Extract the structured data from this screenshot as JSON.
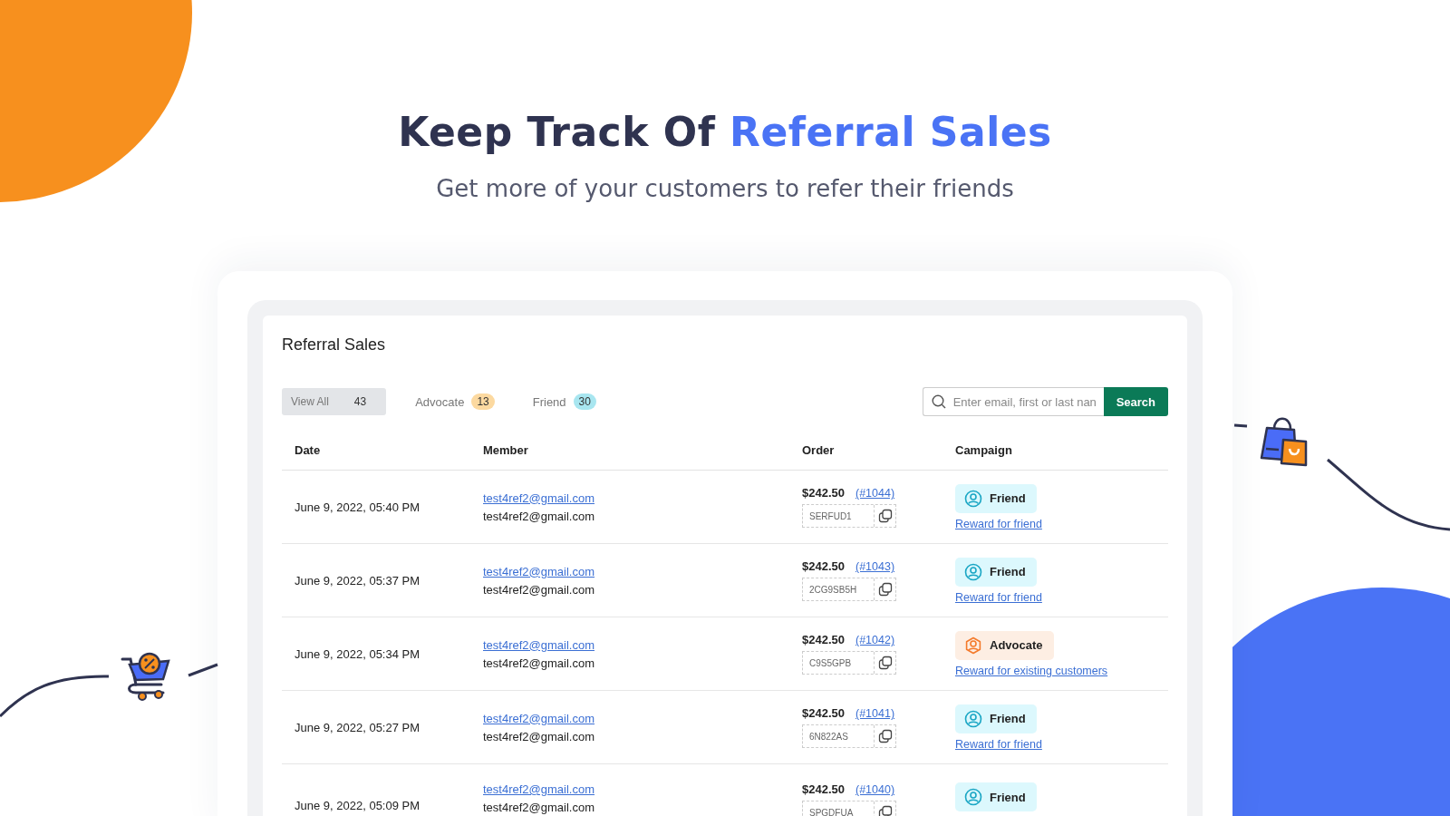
{
  "headline": {
    "text": "Keep Track Of",
    "highlight": "Referral Sales"
  },
  "subtitle": "Get more of your customers to refer their friends",
  "panel": {
    "title": "Referral Sales",
    "tabs": [
      {
        "label": "View All",
        "count": "43",
        "selected": true
      },
      {
        "label": "Advocate",
        "count": "13",
        "selected": false,
        "color": "#fcd9a0"
      },
      {
        "label": "Friend",
        "count": "30",
        "selected": false,
        "color": "#a8e6f0"
      }
    ],
    "search": {
      "placeholder": "Enter email, first or last nan",
      "button": "Search"
    },
    "columns": [
      "Date",
      "Member",
      "Order",
      "Campaign"
    ],
    "rows": [
      {
        "date": "June 9, 2022, 05:40 PM",
        "member_link": "test4ref2@gmail.com",
        "member": "test4ref2@gmail.com",
        "amount": "$242.50",
        "order": "(#1044)",
        "code": "SERFUD1",
        "campaign": {
          "kind": "friend",
          "label": "Friend"
        },
        "reward": "Reward for friend"
      },
      {
        "date": "June 9, 2022, 05:37 PM",
        "member_link": "test4ref2@gmail.com",
        "member": "test4ref2@gmail.com",
        "amount": "$242.50",
        "order": "(#1043)",
        "code": "2CG9SB5H",
        "campaign": {
          "kind": "friend",
          "label": "Friend"
        },
        "reward": "Reward for friend"
      },
      {
        "date": "June 9, 2022, 05:34 PM",
        "member_link": "test4ref2@gmail.com",
        "member": "test4ref2@gmail.com",
        "amount": "$242.50",
        "order": "(#1042)",
        "code": "C9S5GPB",
        "campaign": {
          "kind": "advocate",
          "label": "Advocate"
        },
        "reward": "Reward for existing customers"
      },
      {
        "date": "June 9, 2022, 05:27 PM",
        "member_link": "test4ref2@gmail.com",
        "member": "test4ref2@gmail.com",
        "amount": "$242.50",
        "order": "(#1041)",
        "code": "6N822AS",
        "campaign": {
          "kind": "friend",
          "label": "Friend"
        },
        "reward": "Reward for friend"
      },
      {
        "date": "June 9, 2022, 05:09 PM",
        "member_link": "test4ref2@gmail.com",
        "member": "test4ref2@gmail.com",
        "amount": "$242.50",
        "order": "(#1040)",
        "code": "SPGDFUA",
        "campaign": {
          "kind": "friend",
          "label": "Friend"
        }
      }
    ]
  }
}
